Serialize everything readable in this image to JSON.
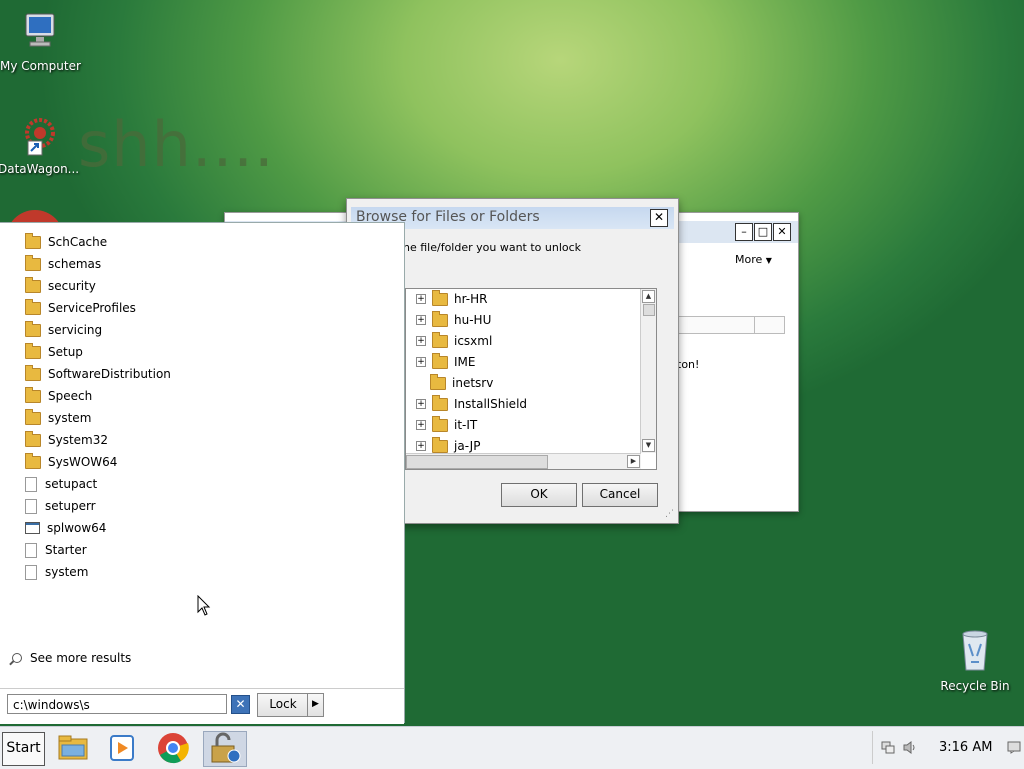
{
  "desktop": {
    "icons": [
      {
        "label": "My Computer"
      },
      {
        "label": "DataWagon..."
      },
      {
        "label": "Recycle Bin"
      }
    ],
    "wallpaper_text": "shh...."
  },
  "back_window": {
    "more_label": "More",
    "status_fragment": "ton!"
  },
  "browse_dialog": {
    "title": "Browse for Files or Folders",
    "prompt": "ne file/folder you want to unlock",
    "tree_items": [
      {
        "label": "hr-HR",
        "expandable": true
      },
      {
        "label": "hu-HU",
        "expandable": true
      },
      {
        "label": "icsxml",
        "expandable": true
      },
      {
        "label": "IME",
        "expandable": true
      },
      {
        "label": "inetsrv",
        "expandable": false
      },
      {
        "label": "InstallShield",
        "expandable": true
      },
      {
        "label": "it-IT",
        "expandable": true
      },
      {
        "label": "ja-JP",
        "expandable": true
      }
    ],
    "ok_label": "OK",
    "cancel_label": "Cancel"
  },
  "search_panel": {
    "results": [
      {
        "label": "SchCache",
        "type": "folder"
      },
      {
        "label": "schemas",
        "type": "folder"
      },
      {
        "label": "security",
        "type": "folder"
      },
      {
        "label": "ServiceProfiles",
        "type": "folder"
      },
      {
        "label": "servicing",
        "type": "folder"
      },
      {
        "label": "Setup",
        "type": "folder"
      },
      {
        "label": "SoftwareDistribution",
        "type": "folder"
      },
      {
        "label": "Speech",
        "type": "folder"
      },
      {
        "label": "system",
        "type": "folder"
      },
      {
        "label": "System32",
        "type": "folder"
      },
      {
        "label": "SysWOW64",
        "type": "folder"
      },
      {
        "label": "setupact",
        "type": "file"
      },
      {
        "label": "setuperr",
        "type": "file"
      },
      {
        "label": "splwow64",
        "type": "exe"
      },
      {
        "label": "Starter",
        "type": "file"
      },
      {
        "label": "system",
        "type": "file"
      }
    ],
    "see_more_label": "See more results",
    "search_value": "c:\\windows\\s",
    "clear_label": "✕",
    "lock_label": "Lock",
    "arrow_label": "▶"
  },
  "taskbar": {
    "start_label": "Start",
    "clock": "3:16 AM"
  },
  "colors": {
    "accent": "#3e73b8",
    "folder": "#e8b940",
    "desktop_green": "#2a7a3c"
  }
}
